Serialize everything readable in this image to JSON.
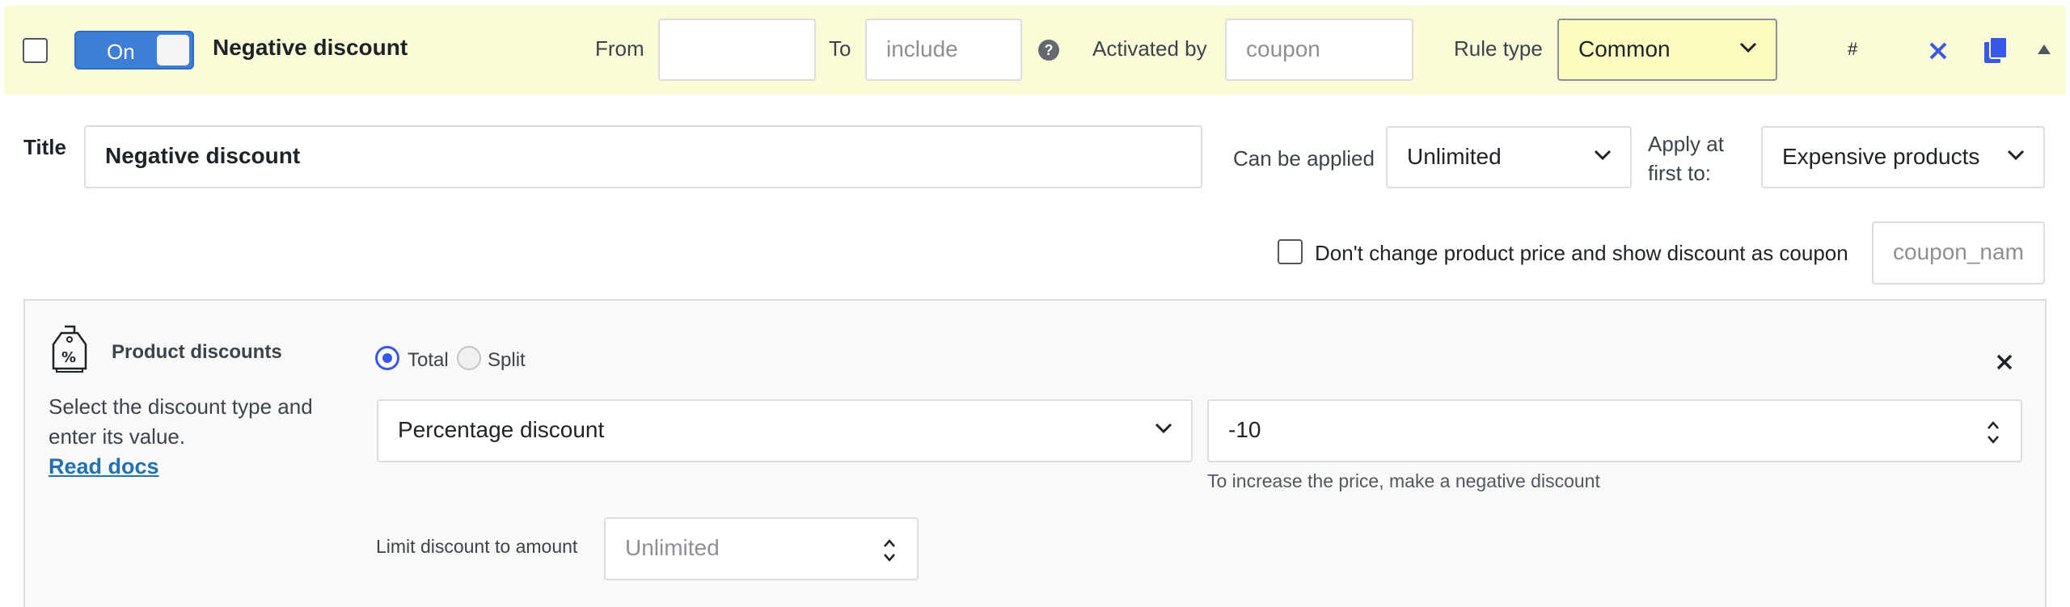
{
  "header": {
    "toggle_label": "On",
    "rule_name": "Negative discount",
    "from_label": "From",
    "from_value": "",
    "to_label": "To",
    "to_placeholder": "include",
    "help_glyph": "?",
    "activated_by_label": "Activated by",
    "activated_by_placeholder": "coupon",
    "rule_type_label": "Rule type",
    "rule_type_value": "Common",
    "hash_label": "#",
    "colors": {
      "header_bg": "#fcfbd7",
      "toggle": "#3d7ed6",
      "action_icons": "#3858e9"
    }
  },
  "settings": {
    "title_label": "Title",
    "title_value": "Negative discount",
    "can_be_applied_label": "Can be applied",
    "can_be_applied_value": "Unlimited",
    "apply_first_label_line1": "Apply at",
    "apply_first_label_line2": "first to:",
    "apply_first_value": "Expensive products",
    "dont_change_label": "Don't change product price and show discount as coupon",
    "coupon_name_placeholder": "coupon_nam"
  },
  "product_discounts": {
    "heading": "Product discounts",
    "description_line1": "Select the discount type and",
    "description_line2": "enter its value.",
    "read_docs": "Read docs",
    "radio_total": "Total",
    "radio_split": "Split",
    "selected_mode": "Total",
    "discount_type_value": "Percentage discount",
    "discount_value": "-10",
    "hint": "To increase the price, make a negative discount",
    "limit_label": "Limit discount to amount",
    "limit_placeholder": "Unlimited"
  }
}
